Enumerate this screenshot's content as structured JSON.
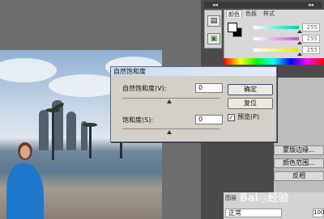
{
  "panel_collapse": {
    "left_arrows": "◂◂",
    "right_arrows": "◂◂"
  },
  "tools": [
    {
      "icon": "clipboard-icon",
      "glyph": "▤"
    },
    {
      "icon": "image-icon",
      "glyph": "▣"
    }
  ],
  "color_panel": {
    "tabs": [
      "颜色",
      "色板",
      "样式"
    ],
    "channels": [
      {
        "value": "255",
        "color": "#00c8c8"
      },
      {
        "value": "255",
        "color": "#d04fd0"
      },
      {
        "value": "255",
        "color": "#e8e800"
      }
    ]
  },
  "adjustments": {
    "ghost_items": [
      "",
      "",
      "",
      ""
    ],
    "side_buttons": [
      "蒙版边缘...",
      "颜色范围...",
      "反相"
    ]
  },
  "layers": {
    "tab_label": "图层",
    "blend_mode": "正常",
    "opacity": "100"
  },
  "watermark": "Bai◎经验",
  "dialog": {
    "title": "自然饱和度",
    "vibrance_label": "自然饱和度(V):",
    "vibrance_value": "0",
    "saturation_label": "饱和度(S):",
    "saturation_value": "0",
    "ok_label": "确定",
    "reset_label": "复位",
    "preview_label": "预览(P)",
    "preview_checked": "✓"
  }
}
